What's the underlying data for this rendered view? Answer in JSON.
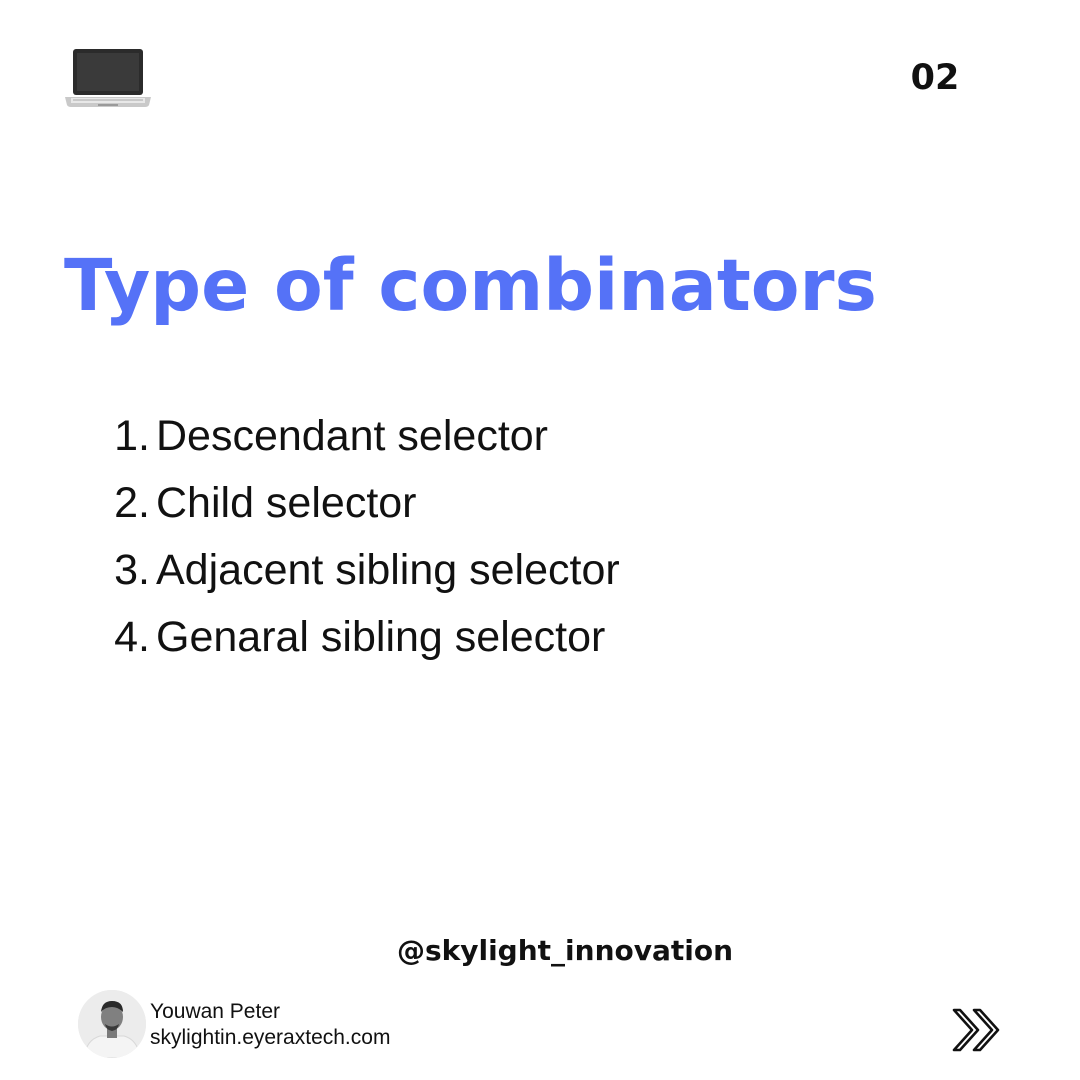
{
  "header": {
    "icon": "laptop-icon",
    "page_number": "02"
  },
  "title": "Type of combinators",
  "title_color": "#5572f7",
  "list": {
    "items": [
      {
        "number": "1.",
        "label": "Descendant selector"
      },
      {
        "number": "2.",
        "label": "Child selector"
      },
      {
        "number": "3.",
        "label": "Adjacent sibling selector"
      },
      {
        "number": "4.",
        "label": "Genaral sibling selector"
      }
    ]
  },
  "footer": {
    "handle": "@skylight_innovation",
    "author": {
      "name": "Youwan Peter",
      "website": "skylightin.eyeraxtech.com"
    },
    "next_icon": "double-chevron-right-icon"
  }
}
